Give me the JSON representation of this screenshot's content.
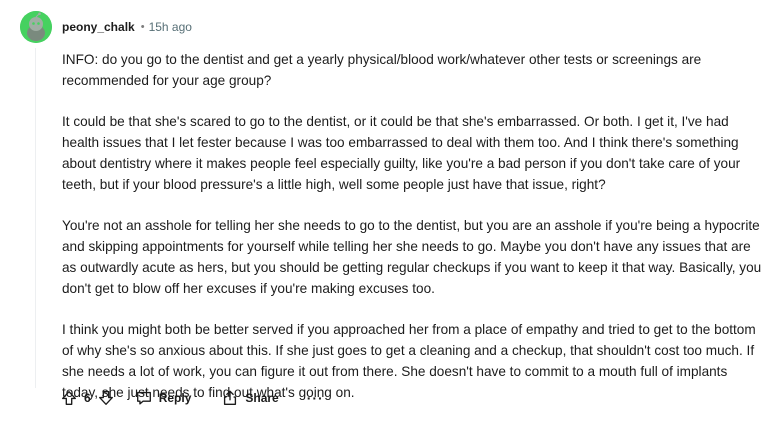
{
  "comment": {
    "author": "peony_chalk",
    "separator": "•",
    "timestamp": "15h ago",
    "paragraphs": [
      "INFO: do you go to the dentist and get a yearly physical/blood work/whatever other tests or screenings are recommended for your age group?",
      "It could be that she's scared to go to the dentist, or it could be that she's embarrassed. Or both. I get it, I've had health issues that I let fester because I was too embarrassed to deal with them too. And I think there's something about dentistry where it makes people feel especially guilty, like you're a bad person if you don't take care of your teeth, but if your blood pressure's a little high, well some people just have that issue, right?",
      "You're not an asshole for telling her she needs to go to the dentist, but you are an asshole if you're being a hypocrite and skipping appointments for yourself while telling her she needs to go. Maybe you don't have any issues that are as outwardly acute as hers, but you should be getting regular checkups if you want to keep it that way. Basically, you don't get to blow off her excuses if you're making excuses too.",
      "I think you might both be better served if you approached her from a place of empathy and tried to get to the bottom of why she's so anxious about this. If she just goes to get a cleaning and a checkup, that shouldn't cost too much. If she needs a lot of work, you can figure it out from there. She doesn't have to commit to a mouth full of implants today, she just needs to find out what's going on."
    ]
  },
  "actions": {
    "score": "6",
    "reply_label": "Reply",
    "share_label": "Share",
    "more_label": "···"
  },
  "colors": {
    "avatar_bg": "#46d160",
    "text": "#1c1c1c",
    "meta": "#576f76"
  }
}
